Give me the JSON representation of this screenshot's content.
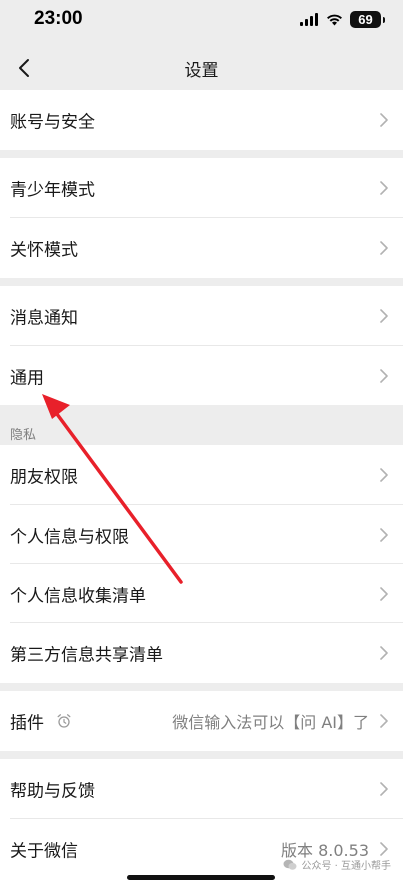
{
  "status_bar": {
    "time": "23:00",
    "battery_level": "69"
  },
  "nav": {
    "title": "设置",
    "back_icon": "chevron-left-icon"
  },
  "groups": [
    {
      "items": [
        {
          "label": "账号与安全"
        }
      ]
    },
    {
      "items": [
        {
          "label": "青少年模式"
        },
        {
          "label": "关怀模式"
        }
      ]
    },
    {
      "items": [
        {
          "label": "消息通知"
        },
        {
          "label": "通用"
        }
      ]
    },
    {
      "header": "隐私",
      "items": [
        {
          "label": "朋友权限"
        },
        {
          "label": "个人信息与权限"
        },
        {
          "label": "个人信息收集清单"
        },
        {
          "label": "第三方信息共享清单"
        }
      ]
    },
    {
      "items": [
        {
          "label": "插件",
          "icon": "alarm-clock-icon",
          "value": "微信输入法可以【问 AI】了"
        }
      ]
    },
    {
      "items": [
        {
          "label": "帮助与反馈"
        },
        {
          "label": "关于微信",
          "value": "版本 8.0.53"
        }
      ]
    }
  ],
  "watermark": {
    "text": "公众号 · 互通小帮手"
  },
  "colors": {
    "page_background": "#ededed",
    "row_background": "#ffffff",
    "annotation_arrow": "#e8202a"
  }
}
